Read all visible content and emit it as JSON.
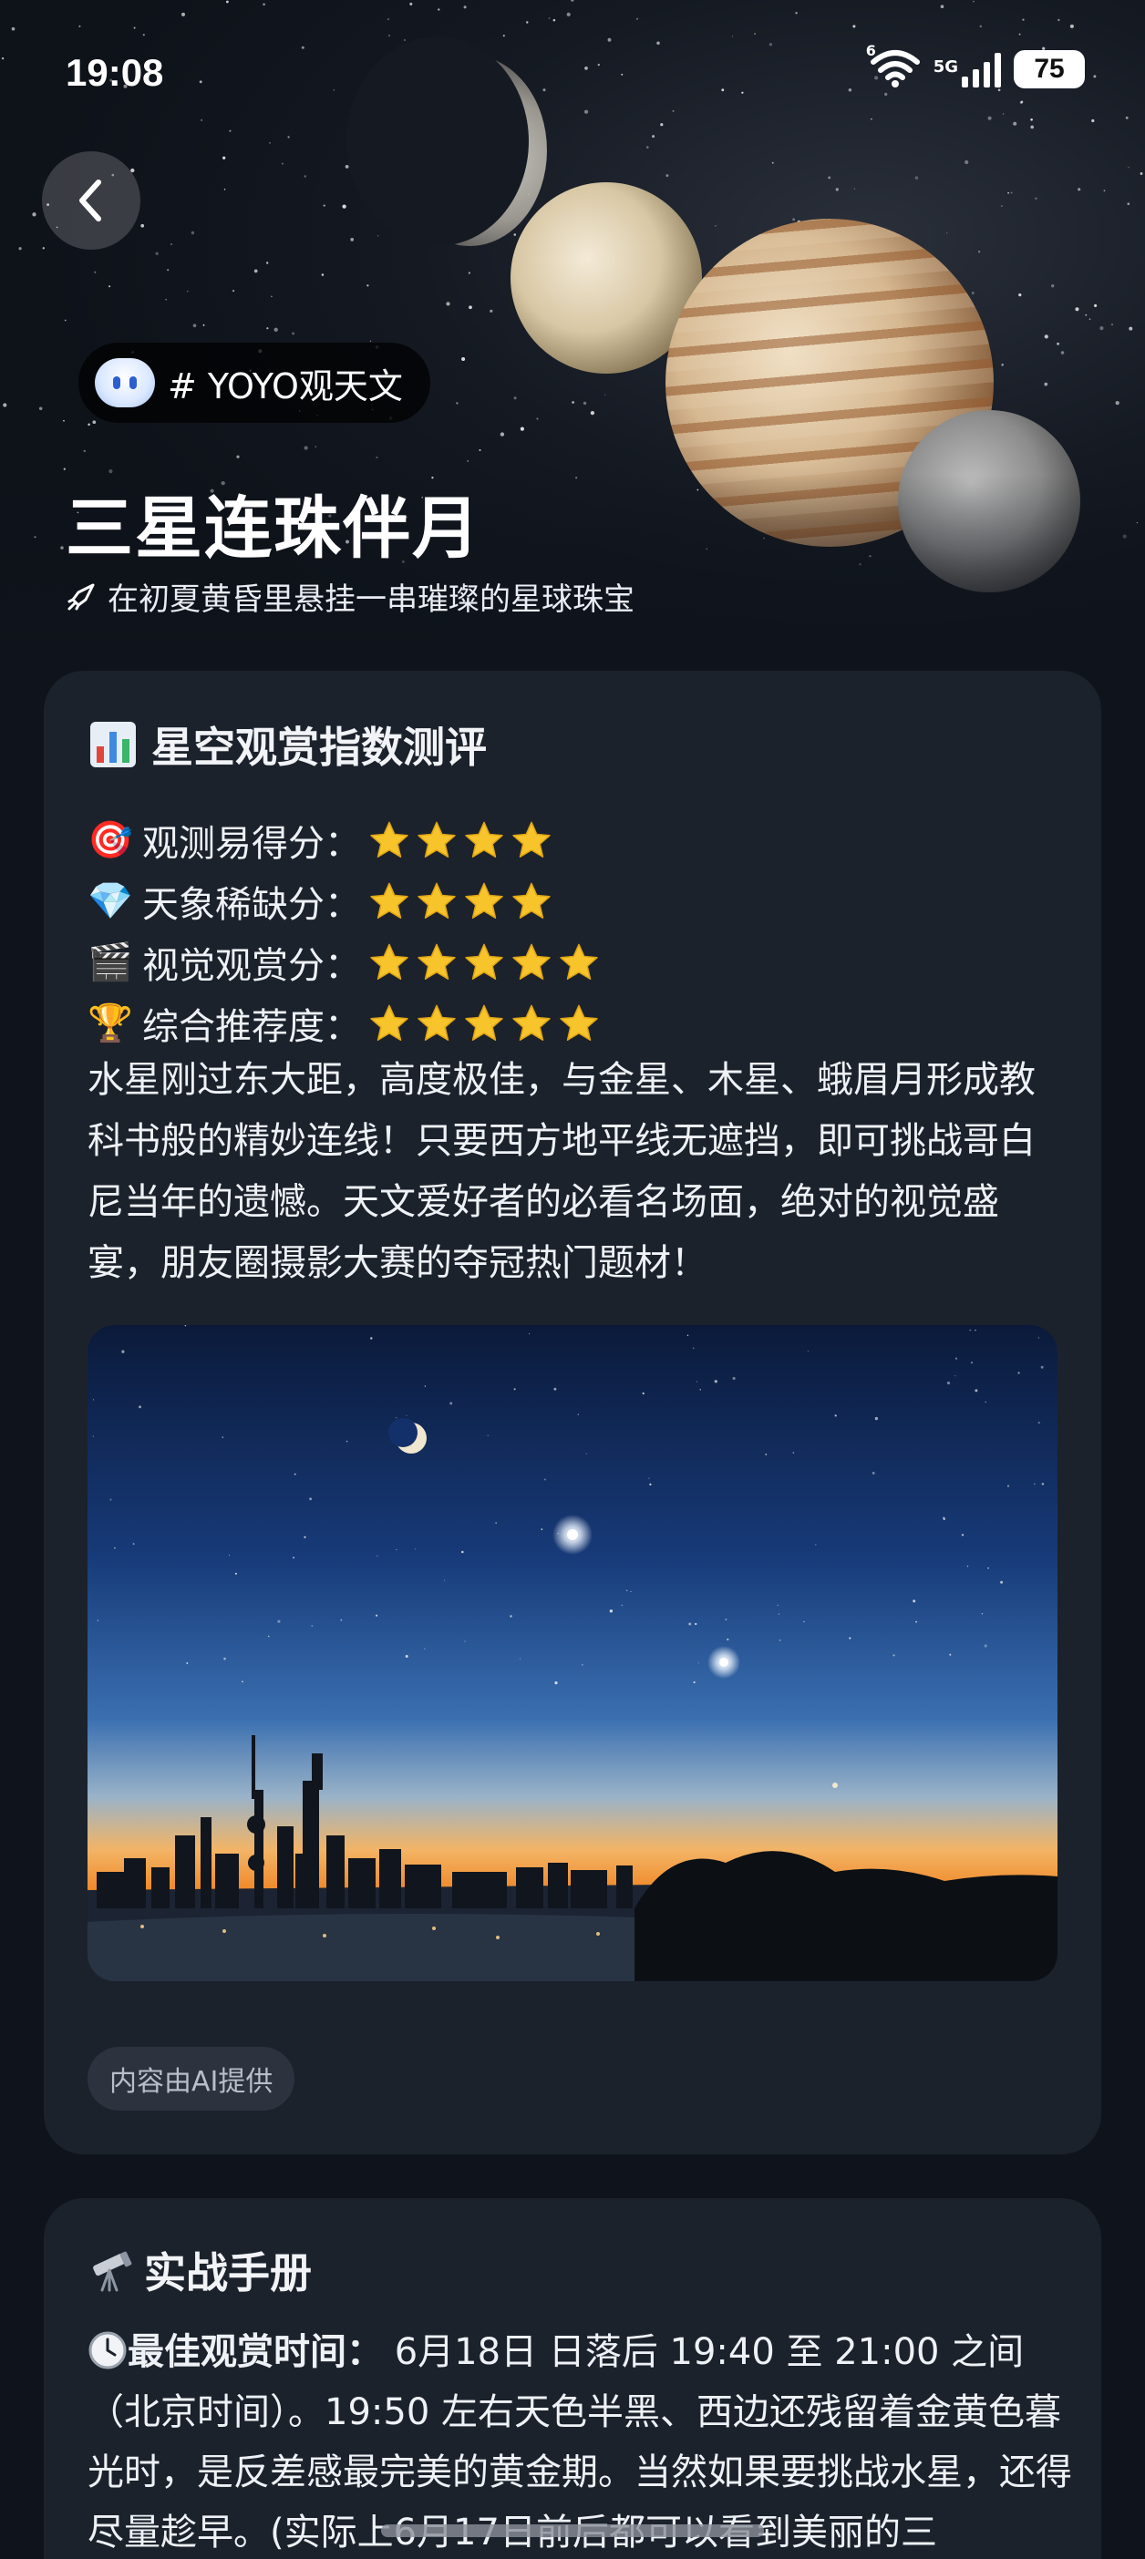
{
  "status_bar": {
    "time": "19:08",
    "wifi_label": "6",
    "network": "5G",
    "battery": "75"
  },
  "header": {
    "tag": "# YOYO观天文",
    "title": "三星连珠伴月",
    "subtitle": "在初夏黄昏里悬挂一串璀璨的星球珠宝"
  },
  "rating_card": {
    "title": "星空观赏指数测评",
    "ratings": [
      {
        "icon": "🎯",
        "label": "观测易得分：",
        "stars": 4
      },
      {
        "icon": "💎",
        "label": "天象稀缺分：",
        "stars": 4
      },
      {
        "icon": "🎬",
        "label": "视觉观赏分：",
        "stars": 5
      },
      {
        "icon": "🏆",
        "label": "综合推荐度：",
        "stars": 5
      }
    ],
    "description": "水星刚过东大距，高度极佳，与金星、木星、蛾眉月形成教科书般的精妙连线！只要西方地平线无遮挡，即可挑战哥白尼当年的遗憾。天文爱好者的必看名场面，绝对的视觉盛宴，朋友圈摄影大赛的夺冠热门题材！",
    "ai_note": "内容由AI提供"
  },
  "guide_card": {
    "title": "实战手册",
    "best_time_label": "最佳观赏时间：",
    "best_time_text": "6月18日 日落后 19:40 至 21:00 之间（北京时间）。19:50 左右天色半黑、西边还残留着金黄色暮光时，是反差感最完美的黄金期。当然如果要挑战水星，还得尽量趁早。(实际上6月17日前后都可以看到美丽的三"
  },
  "colors": {
    "background": "#0f141c",
    "card": "#1c222c",
    "star": "#f7c52b"
  }
}
